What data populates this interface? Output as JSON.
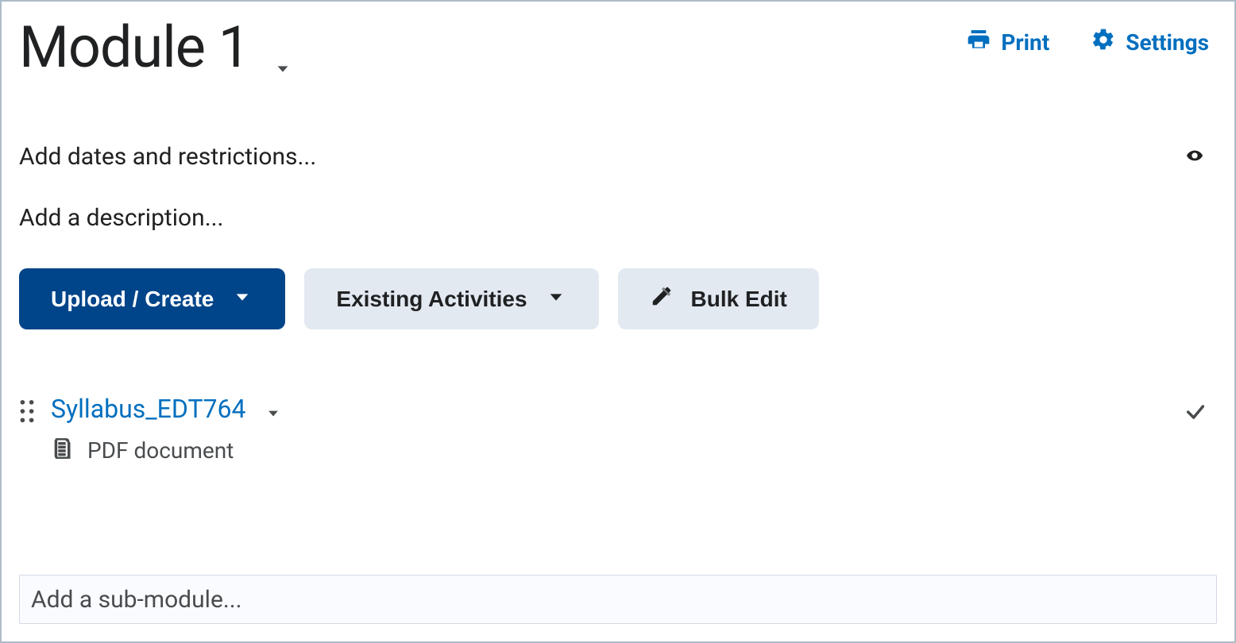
{
  "header": {
    "title": "Module 1",
    "actions": {
      "print": "Print",
      "settings": "Settings"
    }
  },
  "meta": {
    "dates_restrictions": "Add dates and restrictions...",
    "description_placeholder": "Add a description..."
  },
  "buttons": {
    "upload_create": "Upload / Create",
    "existing_activities": "Existing Activities",
    "bulk_edit": "Bulk Edit"
  },
  "content_items": [
    {
      "title": "Syllabus_EDT764",
      "type": "PDF document"
    }
  ],
  "sub_module_placeholder": "Add a sub-module..."
}
